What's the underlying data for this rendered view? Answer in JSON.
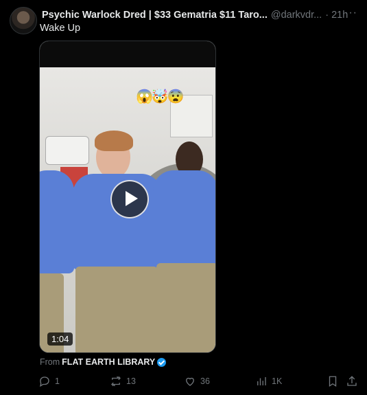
{
  "post": {
    "display_name": "Psychic Warlock Dred | $33 Gematria $11 Taro...",
    "handle": "@darkvdr...",
    "time": "· 21h",
    "more": "···",
    "text": "Wake Up",
    "media": {
      "type": "video",
      "emoji_overlay": "😱🤯😨",
      "duration": "1:04"
    },
    "from": {
      "prefix": "From",
      "source": "FLAT EARTH LIBRARY",
      "verified": true
    },
    "actions": {
      "replies": "1",
      "reposts": "13",
      "likes": "36",
      "views": "1K"
    }
  },
  "icons": {
    "reply": "reply-icon",
    "repost": "repost-icon",
    "like": "heart-icon",
    "views": "views-icon",
    "bookmark": "bookmark-icon",
    "share": "share-icon"
  },
  "colors": {
    "background": "#000000",
    "text": "#e7e9ea",
    "muted": "#71767b",
    "verified": "#1d9bf0"
  }
}
